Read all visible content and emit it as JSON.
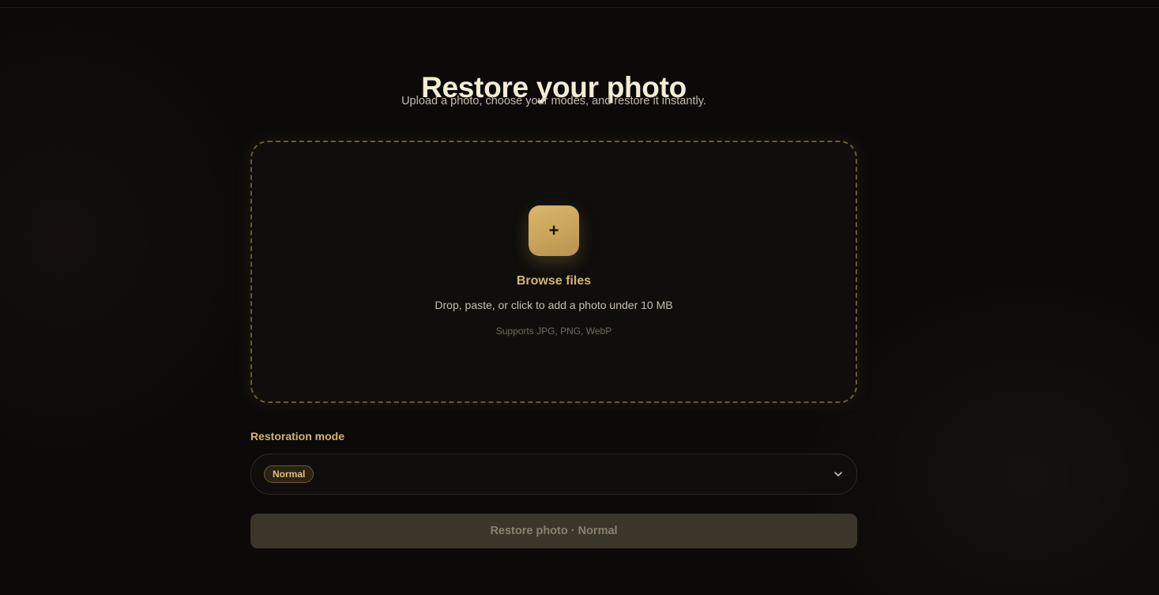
{
  "header": {
    "title": "Restore your photo",
    "subtitle": "Upload a photo, choose your modes, and restore it instantly."
  },
  "upload": {
    "add_icon": "plus-icon",
    "add_symbol": "+",
    "browse_label": "Browse files",
    "hint": "Drop, paste, or click to add a photo under 10 MB",
    "formats": "Supports JPG, PNG, WebP"
  },
  "mode": {
    "label": "Restoration mode",
    "selected": "Normal",
    "dropdown_icon": "chevron-down-icon"
  },
  "action": {
    "restore_label": "Restore photo · Normal",
    "enabled": false
  },
  "colors": {
    "background": "#0b0a08",
    "accent": "#d7b36c",
    "button_gold": "#c9a45a",
    "disabled_button": "#3b352a"
  }
}
